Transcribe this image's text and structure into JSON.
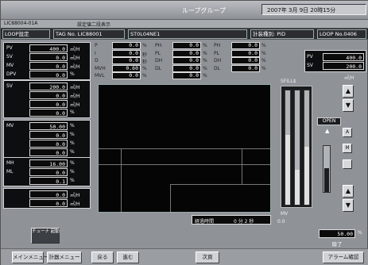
{
  "title": "ループグループ",
  "datetime": "2007年 3月 9日 20時15分",
  "window_tab": "LIC88004-01A",
  "window_subtitle": "設定値二段表示",
  "header": {
    "loop_setting": "LOOP設定",
    "tag_no": "TAG No. LIC88001",
    "tag_name": "ST0L04NE1",
    "control_mode": "計装種別: PID",
    "loop_no": "LOOP No.0406"
  },
  "left_blocks": [
    {
      "rows": [
        {
          "label": "PV",
          "value": "400.0",
          "unit": "㎥/H"
        },
        {
          "label": "SV",
          "value": "0.0",
          "unit": "㎥/H"
        },
        {
          "label": "MV",
          "value": "0.0",
          "unit": "㎥/H"
        },
        {
          "label": "DPV",
          "value": "0.0",
          "unit": "%"
        }
      ]
    },
    {
      "rows": [
        {
          "label": "SV",
          "value": "200.0",
          "unit": "㎥/H"
        },
        {
          "label": "",
          "value": "0.0",
          "unit": "㎥/H"
        },
        {
          "label": "",
          "value": "0.0",
          "unit": "㎥/H"
        },
        {
          "label": "",
          "value": "0.0",
          "unit": "%"
        }
      ]
    },
    {
      "rows": [
        {
          "label": "MV",
          "value": "50.00",
          "unit": "%"
        },
        {
          "label": "",
          "value": "0.0",
          "unit": "%"
        },
        {
          "label": "",
          "value": "0.0",
          "unit": "%"
        },
        {
          "label": "",
          "value": "0.0",
          "unit": "%"
        }
      ]
    },
    {
      "rows": [
        {
          "label": "MH",
          "value": "16.00",
          "unit": "%"
        },
        {
          "label": "ML",
          "value": "0.0",
          "unit": "%"
        },
        {
          "label": "",
          "value": "0.1",
          "unit": "%"
        }
      ]
    },
    {
      "rows": [
        {
          "label": "",
          "value": "0.0",
          "unit": "㎥/H"
        },
        {
          "label": "",
          "value": "0.0",
          "unit": "㎥/H"
        }
      ]
    }
  ],
  "pid_table": [
    {
      "l1": "P",
      "v1": "0.0",
      "u1": "%",
      "l2": "PH",
      "v2": "0.0",
      "u2": "%",
      "l3": "PH",
      "v3": "0.0",
      "u3": "%"
    },
    {
      "l1": "I",
      "v1": "0.0",
      "u1": "秒",
      "l2": "PL",
      "v2": "0.0",
      "u2": "%",
      "l3": "PL",
      "v3": "0.0",
      "u3": "%"
    },
    {
      "l1": "D",
      "v1": "0.0",
      "u1": "秒",
      "l2": "DH",
      "v2": "0.0",
      "u2": "%",
      "l3": "DH",
      "v3": "0.0",
      "u3": "%"
    },
    {
      "l1": "MVH",
      "v1": "0.60",
      "u1": "%",
      "l2": "DL",
      "v2": "0.0",
      "u2": "%",
      "l3": "DL",
      "v3": "0.0",
      "u3": "%"
    },
    {
      "l1": "MVL",
      "v1": "0.0",
      "u1": "%",
      "l2": "",
      "v2": "0.0",
      "u2": "%",
      "l3": "",
      "v3": "",
      "u3": ""
    }
  ],
  "elapsed": {
    "label": "経過時間",
    "value": "0 分  2 秒"
  },
  "right_panel": {
    "pv_label": "PV",
    "pv_value": "400.0",
    "sv_label": "SV",
    "sv_value": "200.0",
    "unit": "㎥/H",
    "bar_title": "SFILL$",
    "open_label": "OPEN",
    "mv_label": "MV",
    "mv_value": "50.00",
    "mv_unit": "%",
    "status": "除了",
    "scale_label": "0.0"
  },
  "buttons": {
    "menu": "メインメニュー",
    "instrument_menu": "計器メニュー",
    "back": "戻る",
    "forward": "進む",
    "next_page": "次頁",
    "alarm": "アラーム確認",
    "tuning": "チューナ 起動"
  }
}
